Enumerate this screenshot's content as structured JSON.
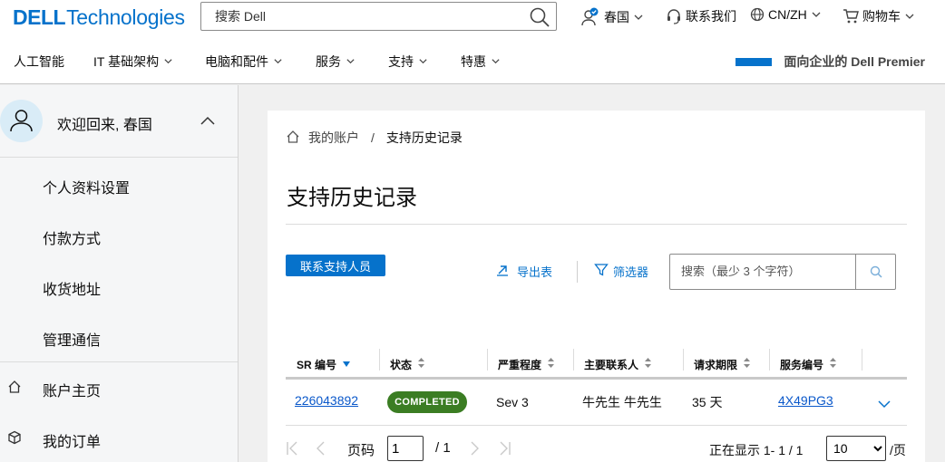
{
  "header": {
    "brand_dell": "DELL",
    "brand_tech": "Technologies",
    "search_placeholder": "搜索 Dell",
    "user_name": "春国",
    "contact_us": "联系我们",
    "locale": "CN/ZH",
    "cart": "购物车"
  },
  "menu": {
    "items": [
      "人工智能",
      "IT 基础架构",
      "电脑和配件",
      "服务",
      "支持",
      "特惠"
    ],
    "premier": "面向企业的 Dell Premier"
  },
  "sidebar": {
    "welcome": "欢迎回来, 春国",
    "sub_items": [
      "个人资料设置",
      "付款方式",
      "收货地址",
      "管理通信"
    ],
    "account_home": "账户主页",
    "my_orders": "我的订单"
  },
  "main": {
    "breadcrumb_root": "我的账户",
    "breadcrumb_sep": "/",
    "breadcrumb_current": "支持历史记录",
    "title": "支持历史记录",
    "contact_button": "联系支持人员",
    "export": "导出表",
    "filter": "筛选器",
    "search_placeholder": "搜索（最少 3 个字符）",
    "columns": [
      "SR 编号",
      "状态",
      "严重程度",
      "主要联系人",
      "请求期限",
      "服务编号"
    ],
    "rows": [
      {
        "sr": "226043892",
        "status": "COMPLETED",
        "severity": "Sev 3",
        "contact": "牛先生 牛先生",
        "age": "35 天",
        "service_tag": "4X49PG3"
      }
    ],
    "pager": {
      "page_label": "页码",
      "page_value": "1",
      "total": "/ 1",
      "showing": "正在显示 1- 1 / 1",
      "per_page": "10",
      "per_label": "/页"
    }
  },
  "colors": {
    "accent": "#0672cb",
    "status_completed": "#3b7d23"
  }
}
